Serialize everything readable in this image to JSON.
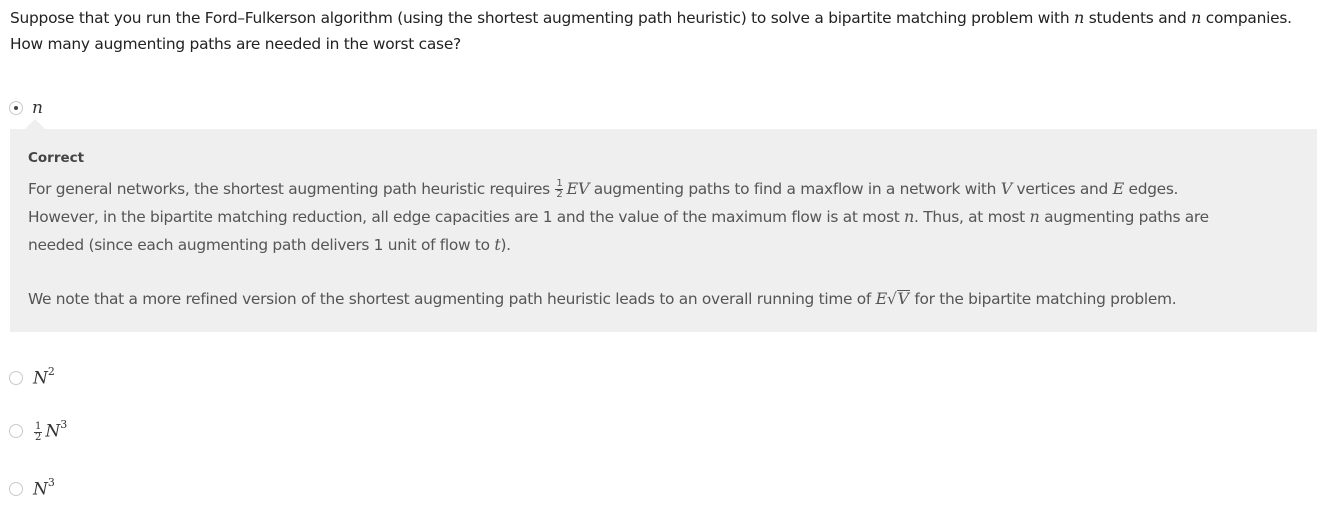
{
  "question": {
    "part1": "Suppose that you run the Ford–Fulkerson algorithm (using the shortest augmenting path heuristic) to solve a bipartite matching problem with ",
    "var1": "n",
    "part2": " students and ",
    "var2": "n",
    "part3": " companies.",
    "part4": "How many augmenting paths are needed in the worst case?"
  },
  "options": [
    {
      "label": "n",
      "selected": true
    },
    {
      "base": "N",
      "exp": "2",
      "selected": false
    },
    {
      "frac_num": "1",
      "frac_den": "2",
      "base": "N",
      "exp": "3",
      "selected": false
    },
    {
      "base": "N",
      "exp": "3",
      "selected": false
    }
  ],
  "feedback": {
    "title": "Correct",
    "p1": {
      "t1": "For general networks, the shortest augmenting path heuristic requires ",
      "frac_num": "1",
      "frac_den": "2",
      "m1": "EV",
      "t2": " augmenting paths to find a maxflow in a network with ",
      "m2": "V",
      "t3": " vertices and ",
      "m3": "E",
      "t4": " edges.",
      "t5": "However, in the bipartite matching reduction, all edge capacities are 1 and the value of the maximum flow is at most ",
      "m4": "n",
      "t6": ". Thus, at most ",
      "m5": "n",
      "t7": " augmenting paths are",
      "t8": "needed (since each augmenting path delivers 1 unit of flow to ",
      "m6": "t",
      "t9": ")."
    },
    "p2": {
      "t1": "We note that a more refined version of the shortest augmenting path heuristic leads to an overall running time of ",
      "m1": "E",
      "sqrt_sign": "√",
      "sqrt_body": "V",
      "t2": " for the bipartite matching problem."
    }
  },
  "colors": {
    "feedback_bg": "#efefef",
    "text": "#222222",
    "feedback_text": "#555555",
    "radio_border": "#c9c9c9"
  }
}
